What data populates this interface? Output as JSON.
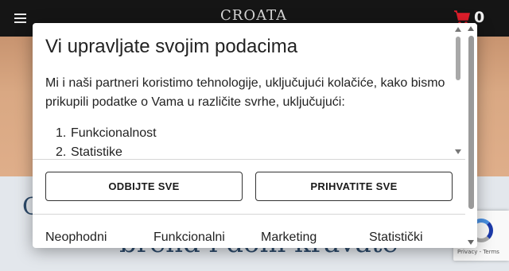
{
  "header": {
    "logo_text": "CROATA",
    "menu_icon": "hamburger-icon",
    "cart_icon": "shopping-cart-icon",
    "cart_count": "0",
    "cart_color": "#e01e2b"
  },
  "background": {
    "line_1": "C",
    "line_2": "brend i doni kravate"
  },
  "recaptcha": {
    "links": "Privacy - Terms"
  },
  "consent": {
    "title": "Vi upravljate svojim podacima",
    "intro": "Mi i naši partneri koristimo tehnologije, uključujući kolačiće, kako bismo prikupili podatke o Vama u različite svrhe, uključujući:",
    "purposes": [
      {
        "num": "1.",
        "label": "Funkcionalnost"
      },
      {
        "num": "2.",
        "label": "Statistike"
      }
    ],
    "reject_label": "ODBIJTE SVE",
    "accept_label": "PRIHVATITE SVE",
    "categories": [
      "Neophodni",
      "Funkcionalni",
      "Marketing",
      "Statistički"
    ]
  }
}
